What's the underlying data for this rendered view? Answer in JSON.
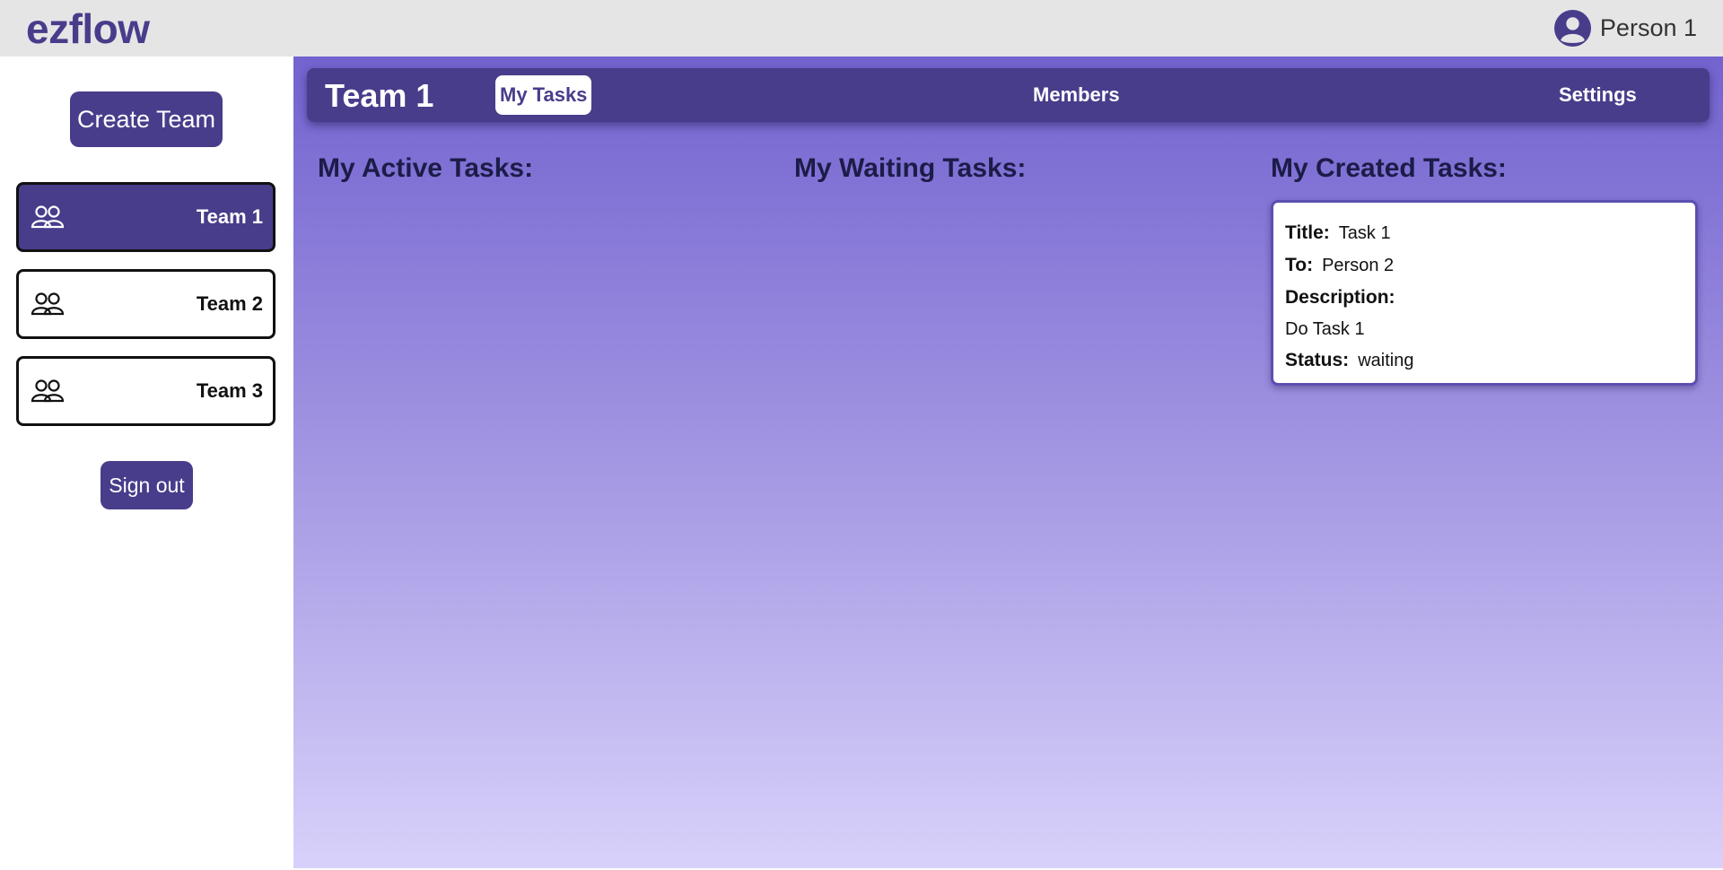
{
  "header": {
    "logo": "ezflow",
    "user_name": "Person 1",
    "user_icon": "account-circle-icon"
  },
  "sidebar": {
    "create_team_label": "Create Team",
    "teams": [
      {
        "label": "Team 1",
        "icon": "people-icon",
        "active": true
      },
      {
        "label": "Team 2",
        "icon": "people-icon",
        "active": false
      },
      {
        "label": "Team 3",
        "icon": "people-icon",
        "active": false
      }
    ],
    "sign_out_label": "Sign out"
  },
  "team_nav": {
    "title": "Team 1",
    "tabs": [
      {
        "label": "My Tasks",
        "active": true
      },
      {
        "label": "Members",
        "active": false
      },
      {
        "label": "Settings",
        "active": false
      }
    ]
  },
  "columns": {
    "active_heading": "My Active Tasks:",
    "waiting_heading": "My Waiting Tasks:",
    "created_heading": "My Created Tasks:"
  },
  "created_tasks": [
    {
      "title_label": "Title:",
      "title": "Task 1",
      "to_label": "To:",
      "to": "Person 2",
      "description_label": "Description:",
      "description": "Do Task 1",
      "status_label": "Status:",
      "status": "waiting"
    }
  ],
  "colors": {
    "brand": "#483d8b",
    "gradient_top": "#7263cf",
    "gradient_bottom": "#d8d1fa",
    "topbar_bg": "#e5e5e5"
  }
}
